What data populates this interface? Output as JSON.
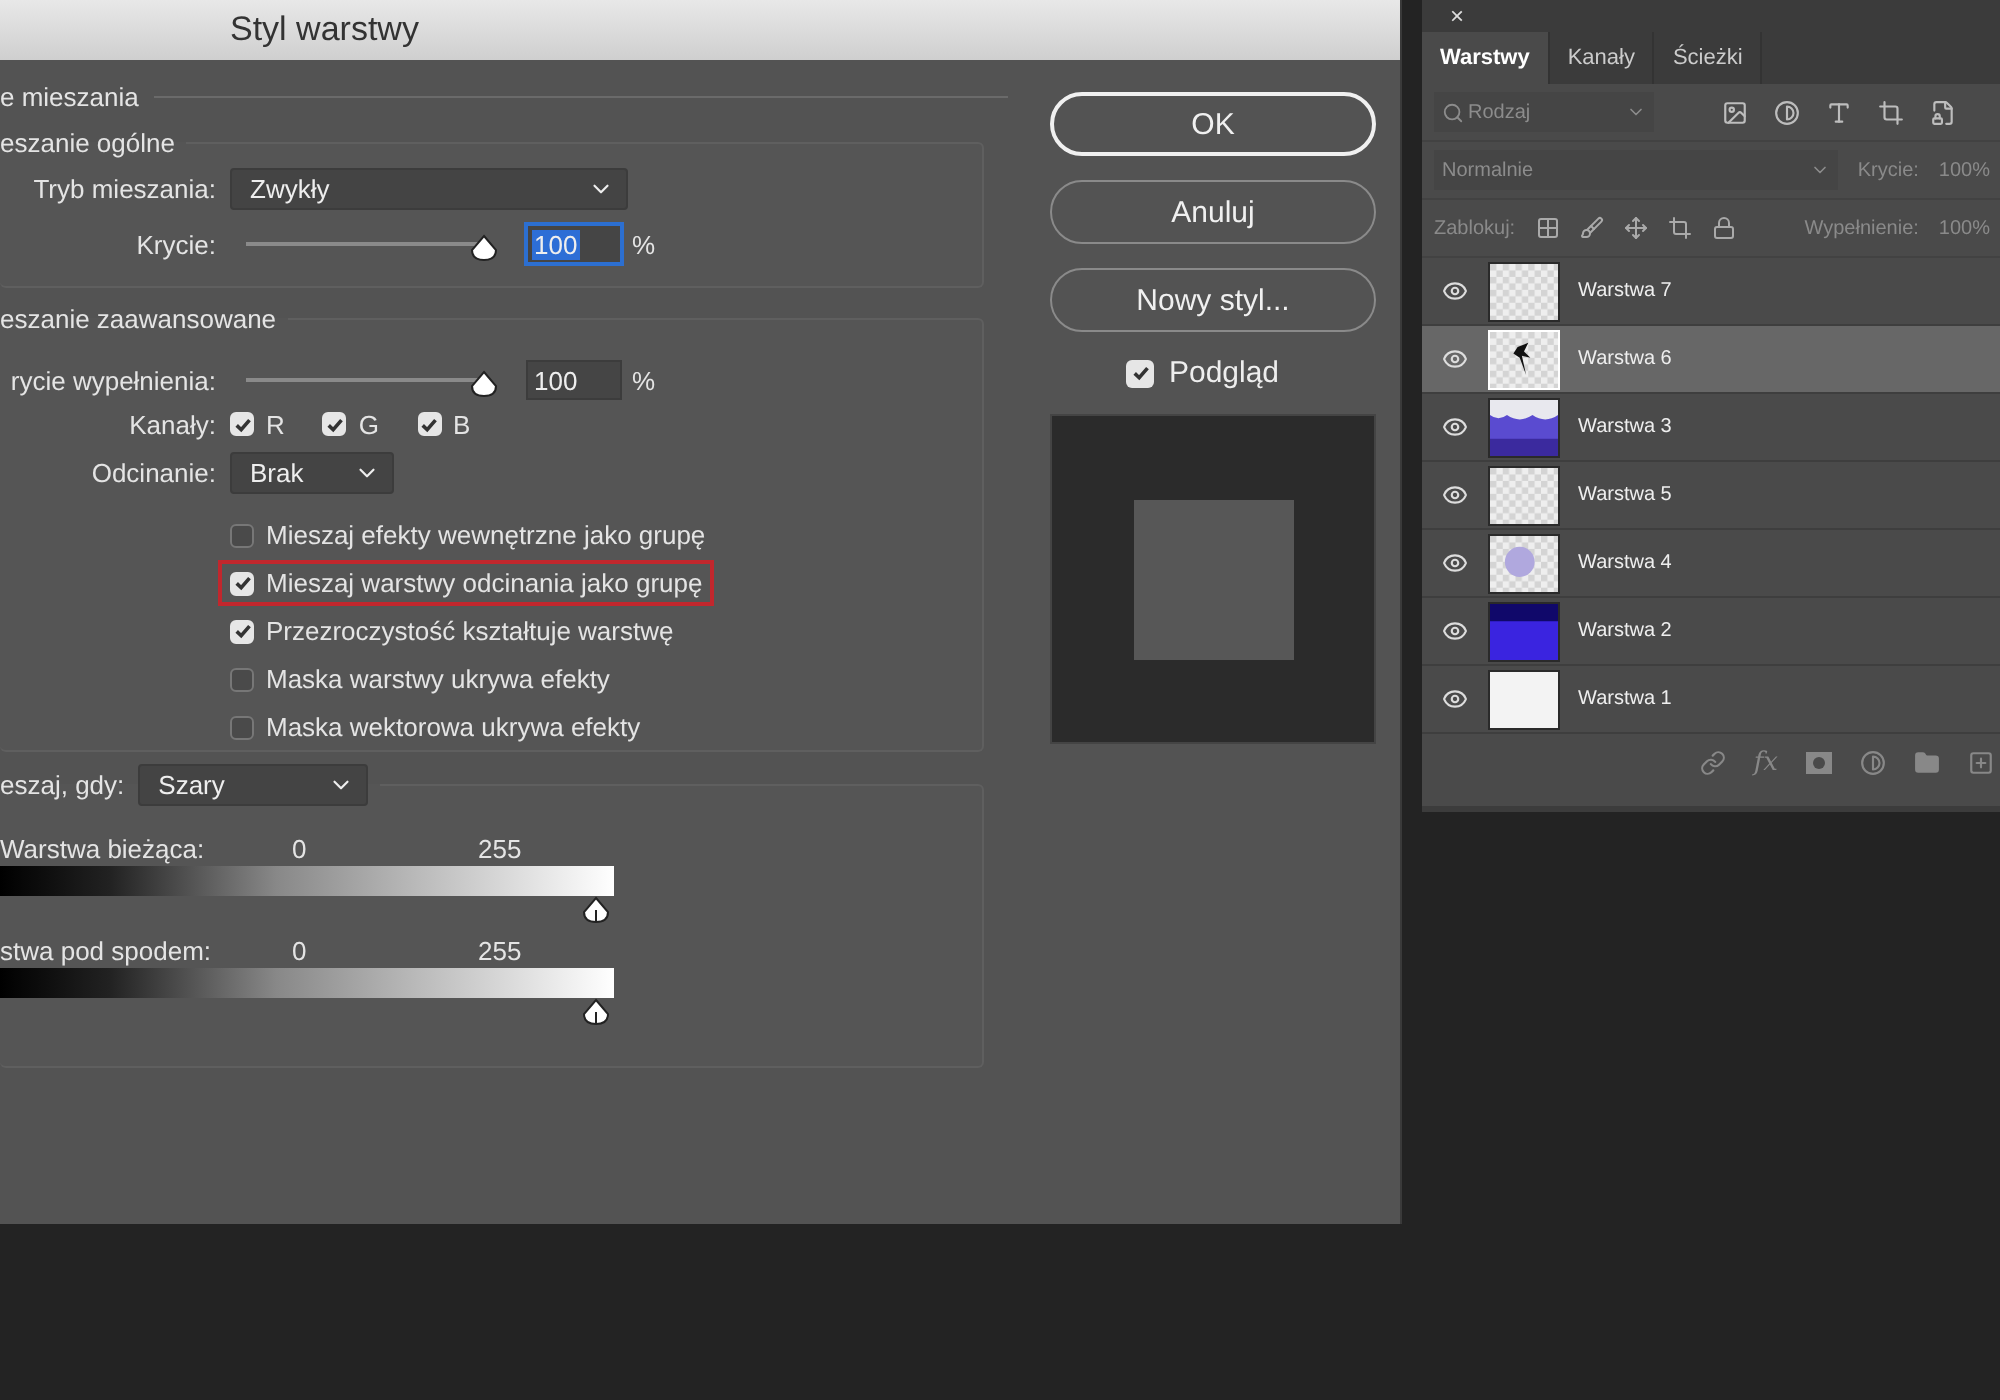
{
  "dialog": {
    "title": "Styl warstwy",
    "section": "e mieszania",
    "general": {
      "legend": "eszanie ogólne",
      "blend_mode": {
        "label": "Tryb mieszania:",
        "value": "Zwykły"
      },
      "opacity": {
        "label": "Krycie:",
        "level": 1,
        "value": "100",
        "focused": true,
        "unit": "%"
      }
    },
    "advanced": {
      "legend": "eszanie zaawansowane",
      "fill_opacity": {
        "label": "rycie wypełnienia:",
        "level": 1,
        "value": "100",
        "focused": false,
        "unit": "%"
      },
      "channels": {
        "label": "Kanały:",
        "items": [
          {
            "label": "R",
            "checked": true
          },
          {
            "label": "G",
            "checked": true
          },
          {
            "label": "B",
            "checked": true
          }
        ]
      },
      "knockout": {
        "label": "Odcinanie:",
        "value": "Brak"
      },
      "options": [
        {
          "label": "Mieszaj efekty wewnętrzne jako grupę",
          "checked": false,
          "highlighted": false
        },
        {
          "label": "Mieszaj warstwy odcinania jako grupę",
          "checked": true,
          "highlighted": true
        },
        {
          "label": "Przezroczystość kształtuje warstwę",
          "checked": true,
          "highlighted": false
        },
        {
          "label": "Maska warstwy ukrywa efekty",
          "checked": false,
          "highlighted": false
        },
        {
          "label": "Maska wektorowa ukrywa efekty",
          "checked": false,
          "highlighted": false
        }
      ]
    },
    "blend_if": {
      "label": "eszaj, gdy:",
      "value": "Szary",
      "bars": [
        {
          "label": "Warstwa bieżąca:",
          "low": "0",
          "high": "255"
        },
        {
          "label": "stwa pod spodem:",
          "low": "0",
          "high": "255"
        }
      ]
    },
    "buttons": [
      {
        "label": "OK",
        "default": true
      },
      {
        "label": "Anuluj",
        "default": false
      },
      {
        "label": "Nowy styl...",
        "default": false
      }
    ],
    "preview": {
      "label": "Podgląd",
      "checked": true
    }
  },
  "layers_panel": {
    "close": "×",
    "tabs": [
      {
        "label": "Warstwy",
        "selected": true
      },
      {
        "label": "Kanały",
        "selected": false
      },
      {
        "label": "Ścieżki",
        "selected": false
      }
    ],
    "filter": {
      "placeholder": "Rodzaj"
    },
    "blend_mode": "Normalnie",
    "opacity_label": "Krycie:",
    "opacity_value": "100%",
    "lock_label": "Zablokuj:",
    "fill_label": "Wypełnienie:",
    "fill_value": "100%",
    "layers": [
      {
        "name": "Warstwa 7",
        "kind": "empty",
        "selected": false
      },
      {
        "name": "Warstwa 6",
        "kind": "figure",
        "selected": true
      },
      {
        "name": "Warstwa 3",
        "kind": "wave",
        "selected": false
      },
      {
        "name": "Warstwa 5",
        "kind": "empty",
        "selected": false
      },
      {
        "name": "Warstwa 4",
        "kind": "blob",
        "selected": false
      },
      {
        "name": "Warstwa 2",
        "kind": "gradient",
        "selected": false
      },
      {
        "name": "Warstwa 1",
        "kind": "white",
        "selected": false
      }
    ],
    "fx": "fx"
  }
}
